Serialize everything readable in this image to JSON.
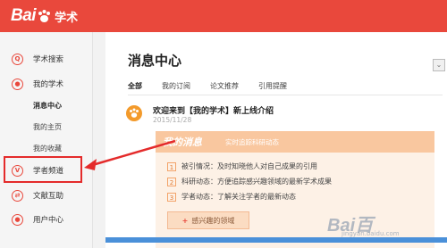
{
  "app": {
    "logo_text_left": "Bai",
    "logo_text_right": "学术"
  },
  "sidebar": {
    "items": [
      {
        "label": "学术搜索",
        "icon": "search-icon"
      },
      {
        "label": "我的学术",
        "icon": "user-icon"
      },
      {
        "label": "学者频道",
        "icon": "scholar-channel-icon"
      },
      {
        "label": "文献互助",
        "icon": "exchange-icon"
      },
      {
        "label": "用户中心",
        "icon": "account-icon"
      }
    ],
    "subitems": [
      {
        "label": "消息中心",
        "active": true
      },
      {
        "label": "我的主页",
        "active": false
      },
      {
        "label": "我的收藏",
        "active": false
      }
    ]
  },
  "main": {
    "title": "消息中心",
    "tabs": [
      "全部",
      "我的订阅",
      "论文推荐",
      "引用提醒"
    ],
    "message": {
      "title": "欢迎来到【我的学术】新上线介绍",
      "date": "2015/11/28"
    },
    "card": {
      "head_big": "我的消息",
      "head_small": "实时追踪科研动态",
      "items": [
        {
          "num": "1",
          "text": "被引情况：及时知晓他人对自己成果的引用"
        },
        {
          "num": "2",
          "text": "科研动态：方便追踪感兴趣领域的最新学术成果"
        },
        {
          "num": "3",
          "text": "学者动态：了解关注学者的最新动态"
        }
      ],
      "button": "感兴趣的领域",
      "button_plus": "+"
    }
  },
  "watermark": {
    "text": "Bai百",
    "sub": "jingyan.baidu.com"
  },
  "colors": {
    "brand": "#e9483c",
    "highlight": "#e42b2b",
    "card_bg": "#fdf1e6",
    "card_head": "#f9c79f"
  }
}
